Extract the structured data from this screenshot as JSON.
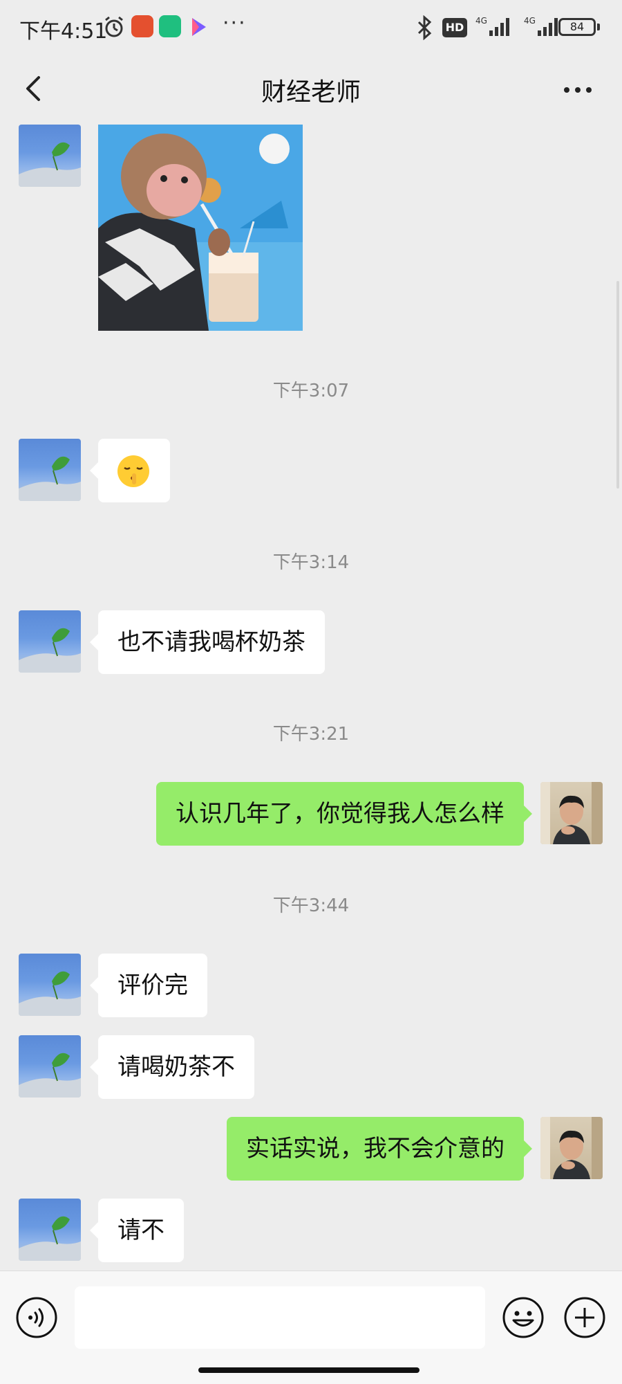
{
  "status_bar": {
    "time": "下午4:51",
    "network_1": "4G",
    "network_2": "4G",
    "hd_label": "HD",
    "battery": "84"
  },
  "header": {
    "title": "财经老师"
  },
  "messages": {
    "ts_1": "下午3:07",
    "ts_2": "下午3:14",
    "ts_3": "下午3:21",
    "ts_4": "下午3:44",
    "msg_milk_tea": "也不请我喝杯奶茶",
    "msg_know_years": "认识几年了，你觉得我人怎么样",
    "msg_review_done": "评价完",
    "msg_treat_tea": "请喝奶茶不",
    "msg_honest": "实话实说，我不会介意的",
    "msg_treat_q": "请不"
  },
  "input": {
    "placeholder": ""
  }
}
